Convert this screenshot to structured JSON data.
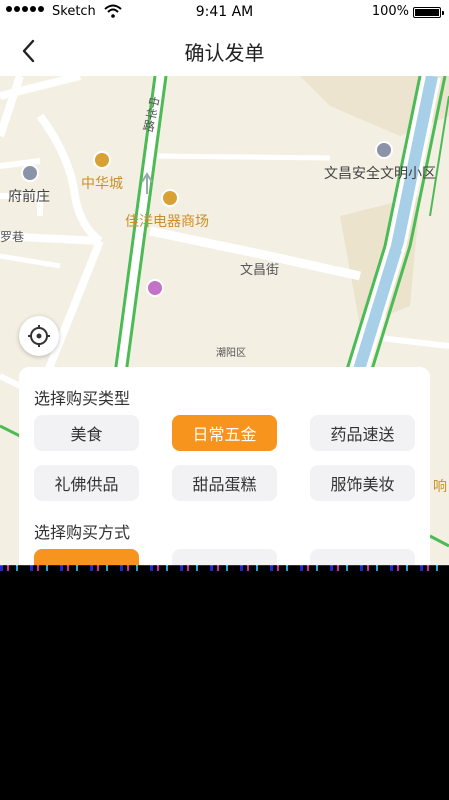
{
  "status_bar": {
    "carrier": "Sketch",
    "time": "9:41 AM",
    "battery": "100%"
  },
  "nav": {
    "title": "确认发单"
  },
  "map": {
    "labels": {
      "fuqianzhuang": "府前庄",
      "zhonghuacheng": "中华城",
      "jiayang": "佳洋电器商场",
      "wenchangjie": "文昌街",
      "wenchang_xiaoqu": "文昌安全文明小区",
      "zhonghualu": "中华路",
      "chaoyangqu": "潮阳区",
      "luoxiang": "罗巷",
      "xiang": "响"
    }
  },
  "panel": {
    "type_title": "选择购买类型",
    "types": [
      {
        "label": "美食"
      },
      {
        "label": "日常五金"
      },
      {
        "label": "药品速送"
      },
      {
        "label": "礼佛供品"
      },
      {
        "label": "甜品蛋糕"
      },
      {
        "label": "服饰美妆"
      }
    ],
    "active_type_index": 1,
    "method_title": "选择购买方式"
  },
  "colors": {
    "accent": "#f7941d",
    "map_bg": "#f4efe3",
    "road_green": "#4cbb55",
    "water": "#a7cfe8"
  }
}
